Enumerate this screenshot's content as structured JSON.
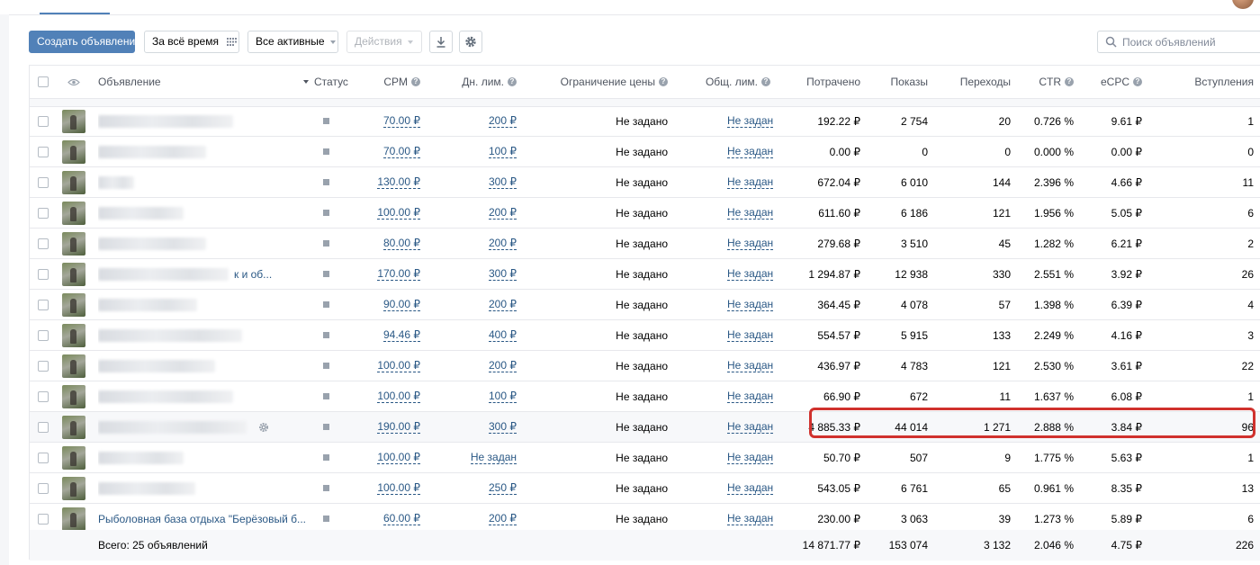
{
  "toolbar": {
    "create_label": "Создать объявление",
    "period_label": "За всё время",
    "filter_label": "Все активные",
    "actions_label": "Действия"
  },
  "search": {
    "placeholder": "Поиск объявлений"
  },
  "table": {
    "headers": {
      "ad": "Объявление",
      "status": "Статус",
      "cpm": "CPM",
      "daily_limit": "Дн. лим.",
      "price_limit": "Ограничение цены",
      "total_limit": "Общ. лим.",
      "spent": "Потрачено",
      "impressions": "Показы",
      "clicks": "Переходы",
      "ctr": "CTR",
      "ecpc": "eCPC",
      "joins": "Вступления"
    },
    "rows": [
      {
        "name": "",
        "cpm": "70.00 ₽",
        "daily": "200 ₽",
        "price": "Не задано",
        "total": "Не задан",
        "spent": "192.22 ₽",
        "impr": "2 754",
        "clicks": "20",
        "ctr": "0.726 %",
        "ecpc": "9.61 ₽",
        "joins": "1"
      },
      {
        "name": "",
        "cpm": "70.00 ₽",
        "daily": "100 ₽",
        "price": "Не задано",
        "total": "Не задан",
        "spent": "0.00 ₽",
        "impr": "0",
        "clicks": "0",
        "ctr": "0.000 %",
        "ecpc": "0.00 ₽",
        "joins": "0"
      },
      {
        "name": "",
        "cpm": "130.00 ₽",
        "daily": "300 ₽",
        "price": "Не задано",
        "total": "Не задан",
        "spent": "672.04 ₽",
        "impr": "6 010",
        "clicks": "144",
        "ctr": "2.396 %",
        "ecpc": "4.66 ₽",
        "joins": "11"
      },
      {
        "name": "",
        "cpm": "100.00 ₽",
        "daily": "200 ₽",
        "price": "Не задано",
        "total": "Не задан",
        "spent": "611.60 ₽",
        "impr": "6 186",
        "clicks": "121",
        "ctr": "1.956 %",
        "ecpc": "5.05 ₽",
        "joins": "6"
      },
      {
        "name": "",
        "cpm": "80.00 ₽",
        "daily": "200 ₽",
        "price": "Не задано",
        "total": "Не задан",
        "spent": "279.68 ₽",
        "impr": "3 510",
        "clicks": "45",
        "ctr": "1.282 %",
        "ecpc": "6.21 ₽",
        "joins": "2"
      },
      {
        "name": "к и об...",
        "cpm": "170.00 ₽",
        "daily": "300 ₽",
        "price": "Не задано",
        "total": "Не задан",
        "spent": "1 294.87 ₽",
        "impr": "12 938",
        "clicks": "330",
        "ctr": "2.551 %",
        "ecpc": "3.92 ₽",
        "joins": "26"
      },
      {
        "name": "",
        "cpm": "90.00 ₽",
        "daily": "200 ₽",
        "price": "Не задано",
        "total": "Не задан",
        "spent": "364.45 ₽",
        "impr": "4 078",
        "clicks": "57",
        "ctr": "1.398 %",
        "ecpc": "6.39 ₽",
        "joins": "4"
      },
      {
        "name": "",
        "cpm": "94.46 ₽",
        "daily": "400 ₽",
        "price": "Не задано",
        "total": "Не задан",
        "spent": "554.57 ₽",
        "impr": "5 915",
        "clicks": "133",
        "ctr": "2.249 %",
        "ecpc": "4.16 ₽",
        "joins": "3"
      },
      {
        "name": "",
        "cpm": "100.00 ₽",
        "daily": "200 ₽",
        "price": "Не задано",
        "total": "Не задан",
        "spent": "436.97 ₽",
        "impr": "4 783",
        "clicks": "121",
        "ctr": "2.530 %",
        "ecpc": "3.61 ₽",
        "joins": "22"
      },
      {
        "name": "",
        "cpm": "100.00 ₽",
        "daily": "100 ₽",
        "price": "Не задано",
        "total": "Не задан",
        "spent": "66.90 ₽",
        "impr": "672",
        "clicks": "11",
        "ctr": "1.637 %",
        "ecpc": "6.08 ₽",
        "joins": "1"
      },
      {
        "name": "",
        "cpm": "190.00 ₽",
        "daily": "300 ₽",
        "price": "Не задано",
        "total": "Не задан",
        "spent": "4 885.33 ₽",
        "impr": "44 014",
        "clicks": "1 271",
        "ctr": "2.888 %",
        "ecpc": "3.84 ₽",
        "joins": "96"
      },
      {
        "name": "",
        "cpm": "100.00 ₽",
        "daily": "Не задан",
        "price": "Не задано",
        "total": "Не задан",
        "spent": "50.70 ₽",
        "impr": "507",
        "clicks": "9",
        "ctr": "1.775 %",
        "ecpc": "5.63 ₽",
        "joins": "1"
      },
      {
        "name": "",
        "cpm": "100.00 ₽",
        "daily": "250 ₽",
        "price": "Не задано",
        "total": "Не задан",
        "spent": "543.05 ₽",
        "impr": "6 761",
        "clicks": "65",
        "ctr": "0.961 %",
        "ecpc": "8.35 ₽",
        "joins": "13"
      },
      {
        "name": "Рыболовная база отдыха \"Берёзовый б...",
        "cpm": "60.00 ₽",
        "daily": "200 ₽",
        "price": "Не задано",
        "total": "Не задан",
        "spent": "230.00 ₽",
        "impr": "3 063",
        "clicks": "39",
        "ctr": "1.273 %",
        "ecpc": "5.89 ₽",
        "joins": "6"
      }
    ],
    "total": {
      "label": "Всего: 25 объявлений",
      "spent": "14 871.77 ₽",
      "impr": "153 074",
      "clicks": "3 132",
      "ctr": "2.046 %",
      "ecpc": "4.75 ₽",
      "joins": "226"
    }
  },
  "colors": {
    "primary": "#5181b8",
    "link": "#2a5885",
    "highlight": "#d0312d"
  }
}
